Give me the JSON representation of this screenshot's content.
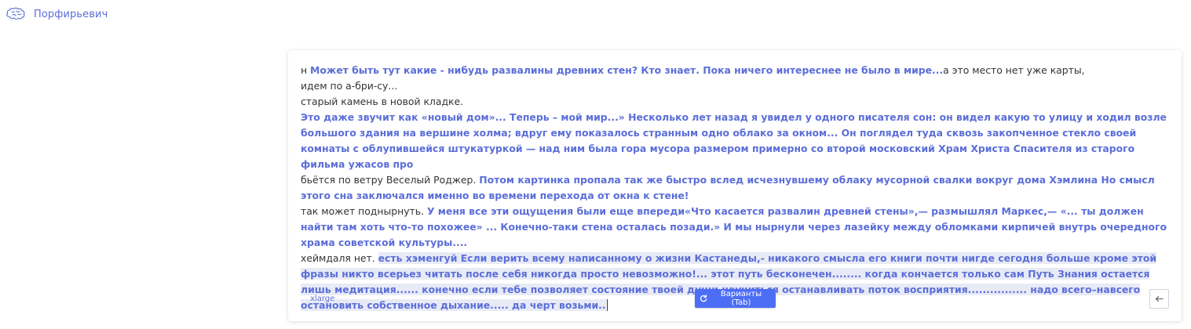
{
  "app": {
    "brand_name": "Порфирьевич",
    "logo_icon": "brain-icon"
  },
  "editor": {
    "segments": [
      {
        "text": "н ",
        "generated": false,
        "selected": false
      },
      {
        "text": "Может быть тут какие - нибудь развалины древних стен? Кто знает. Пока ничего интереснее не было в мире...",
        "generated": true,
        "selected": false
      },
      {
        "text": "а это место нет уже карты,\nидем по а-бри-су...\nстарый камень в новой кладке.\n",
        "generated": false,
        "selected": false
      },
      {
        "text": " Это даже звучит как «новый дом»... Теперь – мой мир...»             Несколько лет назад я увидел у одного писателя сон: он видел какую то улицу и ходил возле большого здания на вершине холма; вдруг ему показалось странным одно облако за окном... Он поглядел туда сквозь закопченное стекло своей комнаты с облупившейся штукатуркой — над ним была гора мусора размером примерно со второй московский Храм Христа Спасителя из старого фильма ужасов про",
        "generated": true,
        "selected": false
      },
      {
        "text": "\nбьётся по ветру Веселый Роджер. ",
        "generated": false,
        "selected": false
      },
      {
        "text": "Потом картинка пропала так же быстро вслед исчезнувшему облаку мусорной свалки вокруг дома Хэмлина Но смысл этого сна заключался именно во времени перехода от окна к стене!",
        "generated": true,
        "selected": false
      },
      {
        "text": "\nтак может поднырнуть. ",
        "generated": false,
        "selected": false
      },
      {
        "text": "У меня все эти ощущения были еще впереди«Что касается развалин древней стены»,— размышлял Маркес,— «... ты должен найти там хоть что-то похожее» ... Конечно-таки стена осталась позади.» И мы нырнули через лазейку между обломками кирпичей внутрь очередного храма советской культуры....",
        "generated": true,
        "selected": false
      },
      {
        "text": "\nхеймдаля нет. ",
        "generated": false,
        "selected": false
      },
      {
        "text": "есть хэменгуй Если верить всему написанному о жизни Кастанеды,- никакого смысла его книги почти нигде сегодня больше кроме этой фразы никто всерьез читать после себя никогда просто невозможно!... этот путь бесконечен........ когда кончается только сам Путь Знания остается лишь медитация...... конечно если тебе позволяет состояние твоей души научиться останавливать поток восприятия................ надо всего–навсего остановить собственное дыхание..... да черт возьми..",
        "generated": true,
        "selected": true
      }
    ]
  },
  "footer": {
    "model_label": "xlarge",
    "variants_label": "Варианты (Tab)",
    "variants_icon": "refresh-icon",
    "back_icon": "arrow-left-icon"
  },
  "colors": {
    "accent": "#5b6ed8",
    "button": "#4c6ef5",
    "selection": "#e8ebf6",
    "text": "#333333"
  }
}
